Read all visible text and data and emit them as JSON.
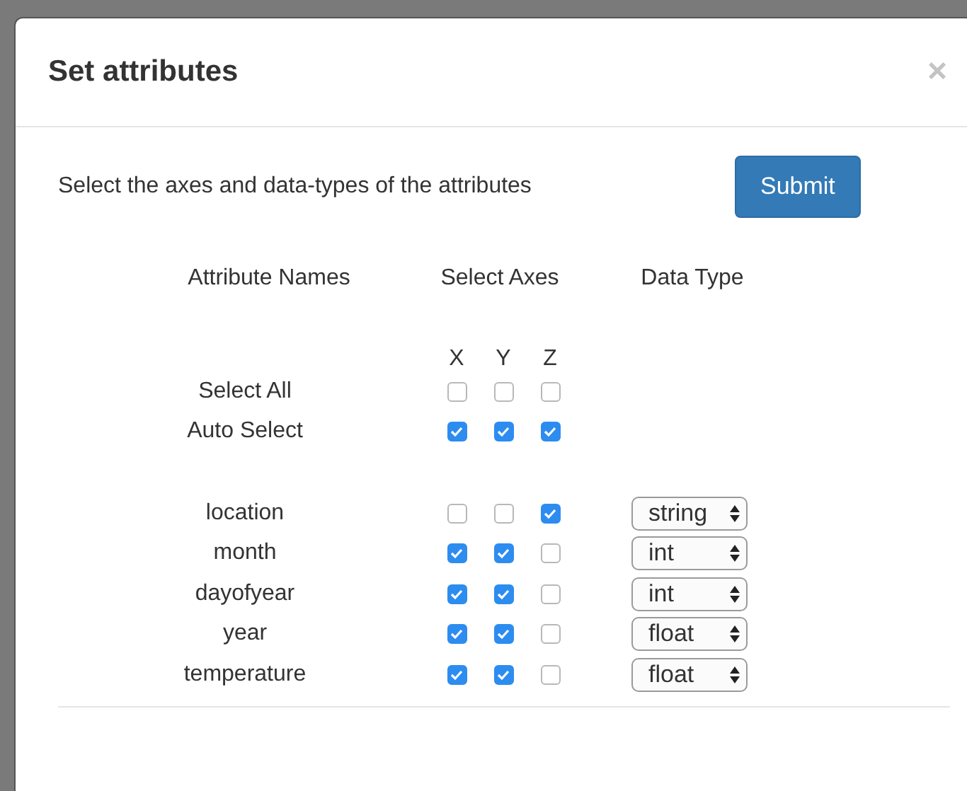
{
  "dialog": {
    "title": "Set attributes",
    "close": "×"
  },
  "instruction": "Select the axes and data-types of the attributes",
  "submit": "Submit",
  "headers": [
    "Attribute Names",
    "Select Axes",
    "Data Type"
  ],
  "axis_labels": [
    "X",
    "Y",
    "Z"
  ],
  "bulk_rows": [
    {
      "label": "Select All",
      "axes": [
        {
          "checked": false
        },
        {
          "checked": false
        },
        {
          "checked": false
        }
      ]
    },
    {
      "label": "Auto Select",
      "axes": [
        {
          "checked": true
        },
        {
          "checked": true
        },
        {
          "checked": true
        }
      ]
    }
  ],
  "attributes": [
    {
      "name": "location",
      "axes": [
        {
          "checked": false
        },
        {
          "checked": false
        },
        {
          "checked": true
        }
      ],
      "type": "string"
    },
    {
      "name": "month",
      "axes": [
        {
          "checked": true
        },
        {
          "checked": true
        },
        {
          "checked": false
        }
      ],
      "type": "int"
    },
    {
      "name": "dayofyear",
      "axes": [
        {
          "checked": true
        },
        {
          "checked": true
        },
        {
          "checked": false
        }
      ],
      "type": "int"
    },
    {
      "name": "year",
      "axes": [
        {
          "checked": true
        },
        {
          "checked": true
        },
        {
          "checked": false
        }
      ],
      "type": "float"
    },
    {
      "name": "temperature",
      "axes": [
        {
          "checked": true
        },
        {
          "checked": true
        },
        {
          "checked": false
        }
      ],
      "type": "float"
    }
  ]
}
